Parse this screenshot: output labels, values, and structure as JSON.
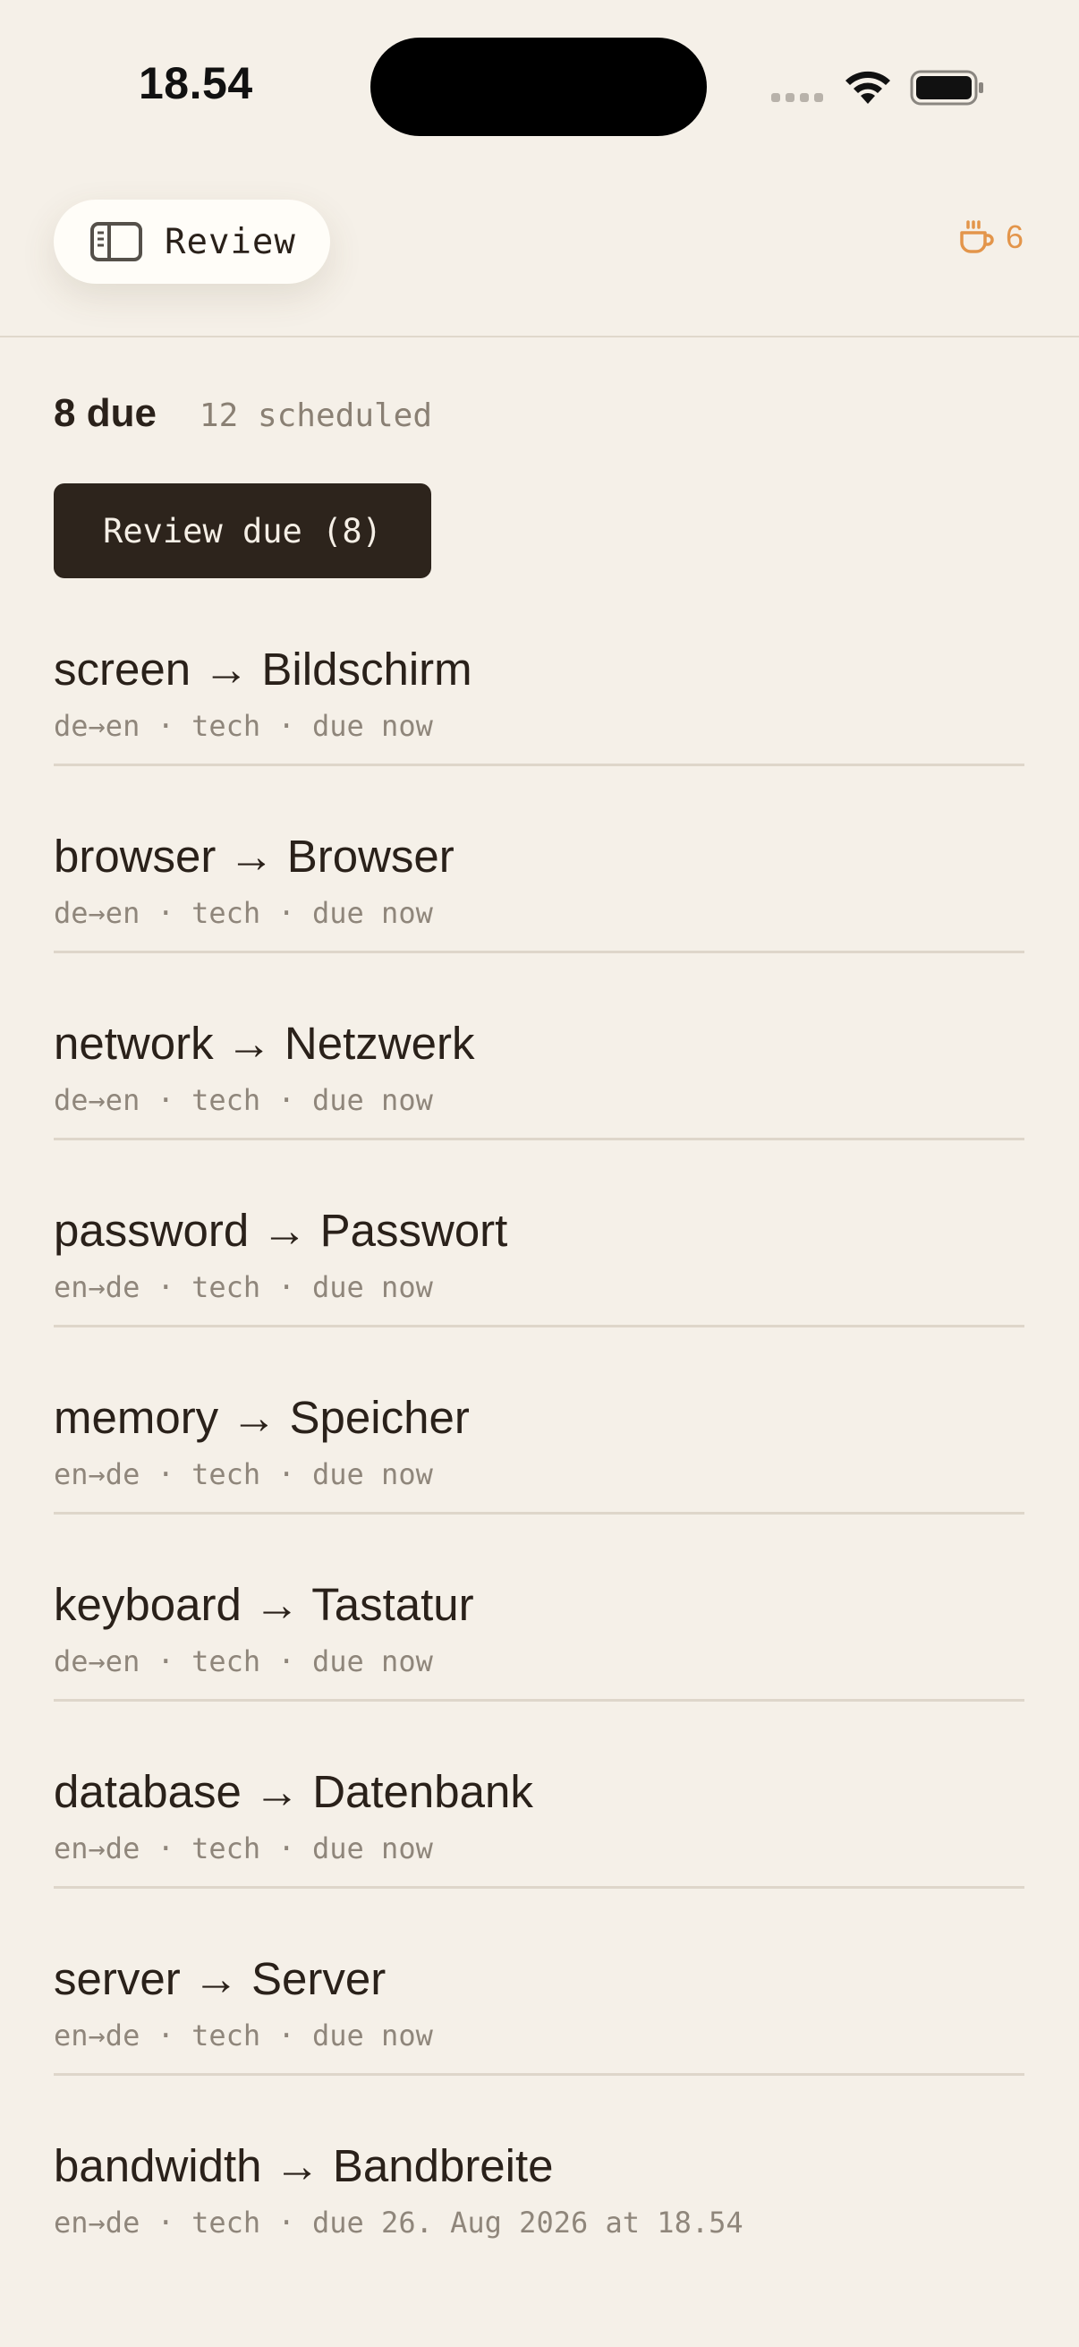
{
  "status_bar": {
    "time": "18.54"
  },
  "header": {
    "title": "Review",
    "streak_count": "6",
    "accent_color": "#e3954a"
  },
  "summary": {
    "due": "8 due",
    "scheduled": "12 scheduled",
    "review_button": "Review due (8)"
  },
  "cards": [
    {
      "term": "screen → Bildschirm",
      "meta": "de→en · tech · due now"
    },
    {
      "term": "browser → Browser",
      "meta": "de→en · tech · due now"
    },
    {
      "term": "network → Netzwerk",
      "meta": "de→en · tech · due now"
    },
    {
      "term": "password → Passwort",
      "meta": "en→de · tech · due now"
    },
    {
      "term": "memory → Speicher",
      "meta": "en→de · tech · due now"
    },
    {
      "term": "keyboard → Tastatur",
      "meta": "de→en · tech · due now"
    },
    {
      "term": "database → Datenbank",
      "meta": "en→de · tech · due now"
    },
    {
      "term": "server → Server",
      "meta": "en→de · tech · due now"
    },
    {
      "term": "bandwidth → Bandbreite",
      "meta": "en→de · tech · due 26. Aug 2026 at 18.54"
    }
  ]
}
